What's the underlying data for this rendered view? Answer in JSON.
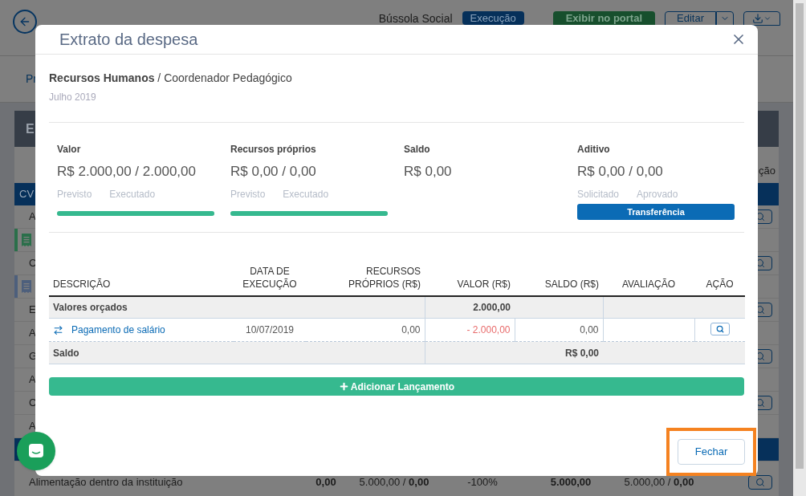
{
  "page": {
    "header": {
      "project": "Bússola Social",
      "status": "Execução",
      "portal_button": "Exibir no portal",
      "edit_button": "Editar"
    },
    "tab_fragment": "Pr",
    "card_fragment": "E",
    "column_fragment": "ção",
    "table_header": "CV",
    "rows": [
      {
        "kind": "text",
        "text": "A",
        "action": true
      },
      {
        "kind": "icon",
        "color": "#2a6f4a",
        "action": false
      },
      {
        "kind": "text",
        "text": "C",
        "action": true
      },
      {
        "kind": "icon",
        "color": "#4d5f7c",
        "action": false
      },
      {
        "kind": "text",
        "text": "E",
        "action": true
      },
      {
        "kind": "text",
        "text": "A",
        "action": false
      },
      {
        "kind": "text",
        "text": "G",
        "action": true
      },
      {
        "kind": "text",
        "text": "A",
        "action": false
      },
      {
        "kind": "text",
        "text": "C",
        "action": true
      },
      {
        "kind": "text",
        "text": "A",
        "action": false
      },
      {
        "kind": "band",
        "action": false
      }
    ],
    "last_row": {
      "name": "Alimentação dentro da instituição",
      "cells": [
        {
          "text": "0,00",
          "bold": true
        },
        {
          "text": "5.000,00 / **0,00**",
          "bold": false
        },
        {
          "text": "-100%",
          "bold": false
        },
        {
          "text": "5.000,00",
          "bold": true
        },
        {
          "text": "5.000,00 / **0,00**",
          "bold": false
        }
      ]
    }
  },
  "modal": {
    "title": "Extrato da despesa",
    "subject": "**Recursos Humanos** / Coordenador Pedagógico",
    "period": "Julho 2019",
    "summary": [
      {
        "kind": "progress",
        "label": "Valor",
        "value": "R$ 2.000,00 / 2.000,00",
        "sublabels": [
          "Previsto",
          "Executado"
        ],
        "level": 1
      },
      {
        "kind": "progress",
        "label": "Recursos próprios",
        "value": "R$ 0,00 / 0,00",
        "sublabels": [
          "Previsto",
          "Executado"
        ],
        "level": 1
      },
      {
        "kind": "plain",
        "label": "Saldo",
        "value": "R$ 0,00"
      },
      {
        "kind": "button",
        "label": "Aditivo",
        "value": "R$ 0,00 / 0,00",
        "sublabels": [
          "Solicitado",
          "Aprovado"
        ],
        "button": "Transferência"
      }
    ],
    "table": {
      "columns": [
        [
          "DESCRIÇÃO"
        ],
        [
          "DATA DE",
          "EXECUÇÃO"
        ],
        [
          "RECURSOS",
          "PRÓPRIOS (R$)"
        ],
        [
          "VALOR (R$)"
        ],
        [
          "SALDO (R$)"
        ],
        [
          "AVALIAÇÃO"
        ],
        [
          "AÇÃO"
        ]
      ],
      "budget_row": {
        "label": "Valores orçados",
        "value": "2.000,00"
      },
      "entries": [
        {
          "description": "Pagamento de salário",
          "date": "10/07/2019",
          "own": "0,00",
          "value": "- 2.000,00",
          "balance": "0,00",
          "negative": true
        }
      ],
      "balance_row": {
        "label": "Saldo",
        "value": "R$ 0,00"
      }
    },
    "add_button": "Adicionar Lançamento",
    "close_button": {
      "label": "Fechar",
      "highlighted": true
    }
  }
}
